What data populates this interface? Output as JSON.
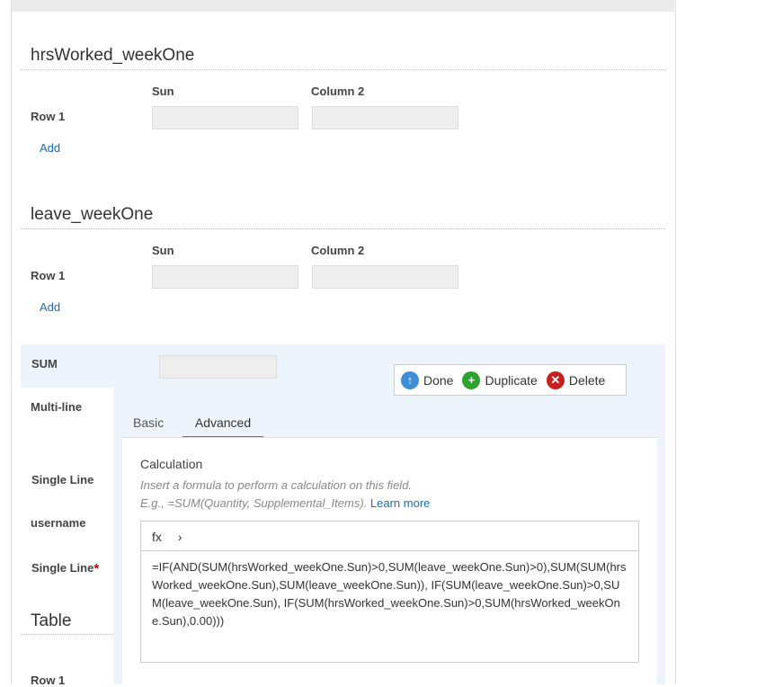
{
  "section1": {
    "title": "hrsWorked_weekOne",
    "col1": "Sun",
    "col2": "Column 2",
    "row": "Row 1",
    "add": "Add"
  },
  "section2": {
    "title": "leave_weekOne",
    "col1": "Sun",
    "col2": "Column 2",
    "row": "Row 1",
    "add": "Add"
  },
  "editor": {
    "field_label": "SUM",
    "actions": {
      "done": "Done",
      "duplicate": "Duplicate",
      "delete": "Delete"
    },
    "tabs": [
      "Basic",
      "Advanced"
    ],
    "active_tab": "Advanced",
    "calc_title": "Calculation",
    "calc_help1": "Insert a formula to perform a calculation on this field.",
    "calc_help2": "E.g., =SUM(Quantity, Supplemental_Items).",
    "learn_more": "Learn more",
    "fx": "fx",
    "formula": "=IF(AND(SUM(hrsWorked_weekOne.Sun)>0,SUM(leave_weekOne.Sun)>0),SUM(SUM(hrsWorked_weekOne.Sun),SUM(leave_weekOne.Sun)), IF(SUM(leave_weekOne.Sun)>0,SUM(leave_weekOne.Sun), IF(SUM(hrsWorked_weekOne.Sun)>0,SUM(hrsWorked_weekOne.Sun),0.00)))"
  },
  "left_fields": [
    "Multi-line",
    "Single Line",
    "username",
    "Single Line"
  ],
  "required_mark": "*",
  "table_title": "Table",
  "table_row": "Row 1"
}
